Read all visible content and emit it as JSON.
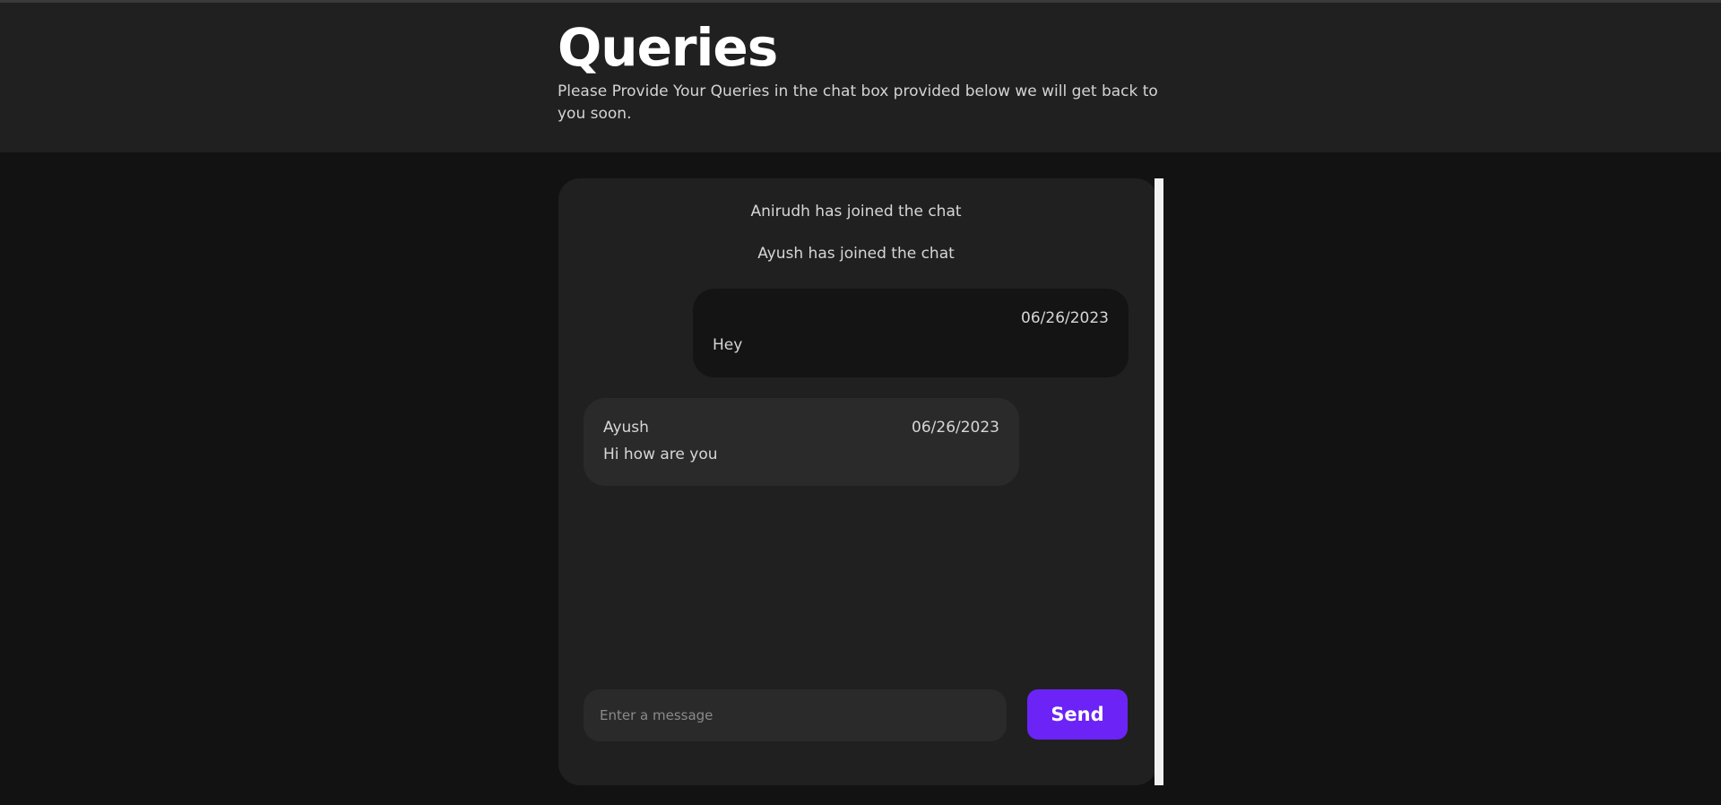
{
  "header": {
    "title": "Queries",
    "subtitle": "Please Provide Your Queries in the chat box provided below we will get back to you soon."
  },
  "chat": {
    "system_messages": [
      "Anirudh has joined the chat",
      "Ayush has joined the chat"
    ],
    "messages": [
      {
        "sender": "",
        "date": "06/26/2023",
        "text": "Hey",
        "own": true
      },
      {
        "sender": "Ayush",
        "date": "06/26/2023",
        "text": "Hi how are you",
        "own": false
      }
    ],
    "composer": {
      "placeholder": "Enter a message",
      "send_label": "Send"
    }
  },
  "colors": {
    "page_background": "#121212",
    "header_background": "#202020",
    "card_background": "#202020",
    "own_bubble": "#141414",
    "other_bubble": "#2a2a2a",
    "accent": "#6b24f5"
  }
}
